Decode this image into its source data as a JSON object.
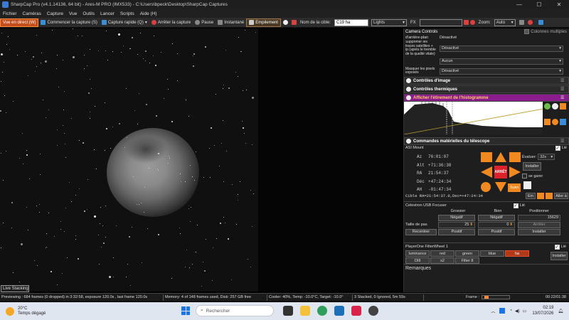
{
  "window": {
    "title": "SharpCap Pro (v4.1.14136, 64 bit) - Ares-M PRO (IMX533) - C:\\Users\\bpeck\\Desktop\\SharpCap Captures",
    "min": "—",
    "max": "☐",
    "close": "✕"
  },
  "menu": [
    "Fichier",
    "Caméras",
    "Capture",
    "Vue",
    "Outils",
    "Lancer",
    "Scripts",
    "Aide (H)"
  ],
  "toolbar": {
    "live": "Vue en direct (W)",
    "start_capture": "Commencer la capture (S)",
    "quick_capture": "Capture rapide (Q)",
    "stop_capture": "Arrêter la capture",
    "pause": "Pause",
    "snapshot": "Instantané",
    "stacking": "Empilement",
    "target_label": "Nom de la cible:",
    "target_value": "C19 ha",
    "frame_type": "Lights",
    "fx_label": "FX",
    "zoom_label": "Zoom:",
    "zoom_value": "Auto"
  },
  "panel": {
    "camera_controls": "Camera Controls",
    "options_label": "Colonnes multiples",
    "rows": [
      {
        "label": "d'arrière-plan",
        "value": "Désactivé"
      },
      {
        "label": "Supprimer les traces satellites + ip (après le tremble de la qualité vitale)",
        "value": "Désactivé"
      },
      {
        "label": "",
        "value": "Aucun"
      },
      {
        "label": "Masquer les pixels exposés",
        "value": "Désactivé"
      }
    ],
    "image_controls": "Contrôles d'image",
    "thermal_controls": "Contrôles thermiques",
    "histogram_title": "Afficher l'étirement de l'histogramme",
    "telescope_title": "Commandes matérielles du télescope",
    "mount": {
      "name": "ASI Mount",
      "linked": "Lié",
      "az_label": "Az",
      "az": "76:01:07",
      "alt_label": "Alt",
      "alt": "+71:36:38",
      "ra_label": "RA",
      "ra": "21:54:37",
      "dec_label": "Déc",
      "dec": "+47:24:34",
      "ah_label": "AH",
      "ah": "-01:47:34",
      "stop": "ARRÊT",
      "rate_label": "Évaluer:",
      "rate": "32x",
      "install": "Installer",
      "no_park": "se garer",
      "follow": "Suivi",
      "target_line": "Cible  RA=21:54:37.0,Dec=+47:24:34",
      "go_button": "Aller à",
      "em_button": "Em"
    },
    "focuser": {
      "name": "Celestron USB Focuser",
      "linked": "Lié",
      "col_coarse": "Grossier",
      "col_fine": "Bien",
      "col_position": "Positionner",
      "neg": "Négatif",
      "pos": "Positif",
      "position": "15629",
      "step_label": "Taille de pas",
      "coarse_step": "25",
      "fine_step": "0",
      "stop": "Arrêter",
      "reset": "Recentrer",
      "install": "Installer"
    },
    "filterwheel": {
      "name": "PlayerOne FilterWheel 1",
      "linked": "Lié",
      "filters": [
        "luminance",
        "red",
        "green",
        "blue",
        "ha",
        "OIII",
        "s2",
        "Filter 8"
      ],
      "active": "ha",
      "install": "Installer"
    },
    "notes_label": "Remarques"
  },
  "live_stacking": "Live Stacking",
  "status": {
    "previewing": "Previewing : 684 frames (0 dropped) in 3:32:58, exposure 120.0s , last frame 120.0s",
    "memory": "Memory: 4 of 148 frames used, Disk: 257 GB free",
    "cooler": "Cooler: 40%, Temp: -10.0°C, Target: -10.0°",
    "stacked": "3 Stacked, 0 Ignored, 5m 59s",
    "frame_label": "Frame :",
    "elapsed": "00:22/01:38",
    "frame_progress": 0.1
  },
  "taskbar": {
    "temp": "20°C",
    "weather": "Temps dégagé",
    "search": "Rechercher",
    "time": "02:19",
    "date": "13/07/2026"
  },
  "colors": {
    "accent": "#c44e1c",
    "histogram_header": "#8b1c8b",
    "filter_active": "#b0391a",
    "nav_arrow": "#f08a20"
  }
}
